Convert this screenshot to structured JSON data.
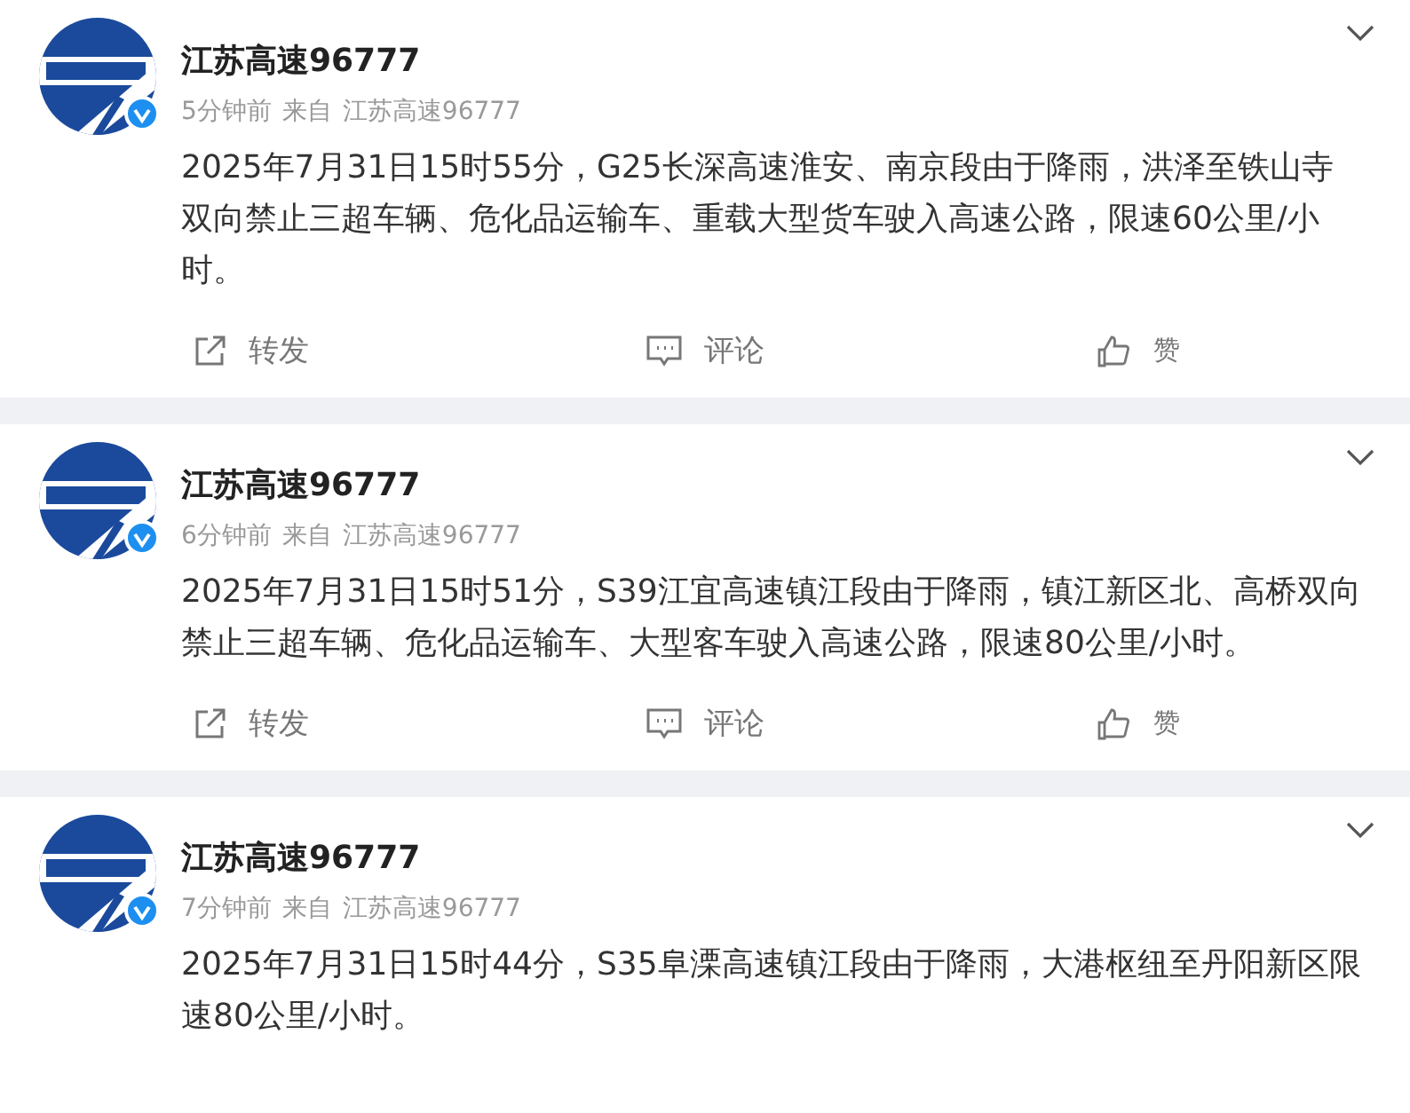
{
  "posts": [
    {
      "author": "江苏高速96777",
      "verified": true,
      "time": "5分钟前",
      "source_prefix": "来自",
      "source": "江苏高速96777",
      "text": "2025年7月31日15时55分，G25长深高速淮安、南京段由于降雨，洪泽至铁山寺双向禁止三超车辆、危化品运输车、重载大型货车驶入高速公路，限速60公里/小时。",
      "actions": [
        {
          "kind": "repost",
          "label": "转发"
        },
        {
          "kind": "comment",
          "label": "评论"
        },
        {
          "kind": "like",
          "label": "赞"
        }
      ]
    },
    {
      "author": "江苏高速96777",
      "verified": true,
      "time": "6分钟前",
      "source_prefix": "来自",
      "source": "江苏高速96777",
      "text": "2025年7月31日15时51分，S39江宜高速镇江段由于降雨，镇江新区北、高桥双向禁止三超车辆、危化品运输车、大型客车驶入高速公路，限速80公里/小时。",
      "actions": [
        {
          "kind": "repost",
          "label": "转发"
        },
        {
          "kind": "comment",
          "label": "评论"
        },
        {
          "kind": "like",
          "label": "赞"
        }
      ]
    },
    {
      "author": "江苏高速96777",
      "verified": true,
      "time": "7分钟前",
      "source_prefix": "来自",
      "source": "江苏高速96777",
      "text": "2025年7月31日15时44分，S35阜溧高速镇江段由于降雨，大港枢纽至丹阳新区限速80公里/小时。"
    }
  ]
}
